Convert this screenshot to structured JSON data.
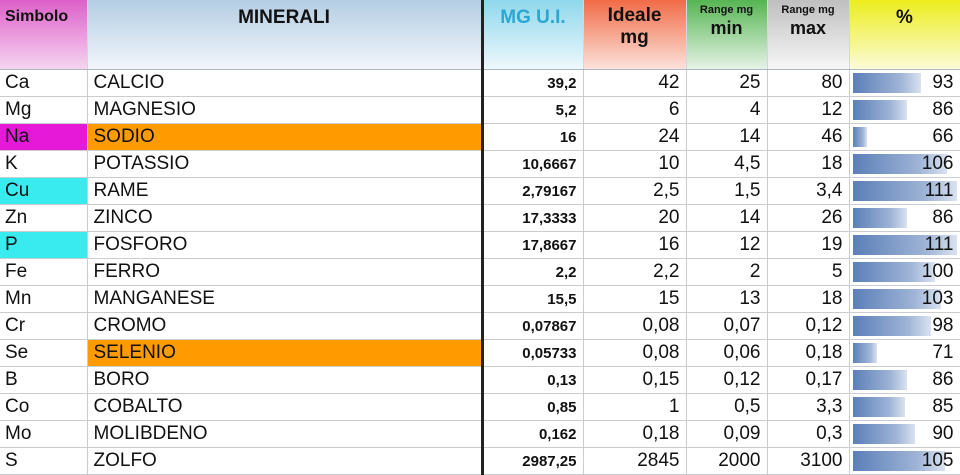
{
  "headers": {
    "simbolo": "Simbolo",
    "minerali": "MINERALI",
    "mg_ui": "MG U.I.",
    "ideale_line1": "Ideale",
    "ideale_line2": "mg",
    "range_min_line1": "Range mg",
    "range_min_line2": "min",
    "range_max_line1": "Range mg",
    "range_max_line2": "max",
    "pct": "%"
  },
  "colors": {
    "highlight_magenta": "#e619d8",
    "highlight_orange": "#ff9a00",
    "highlight_cyan": "#39ebee",
    "bar_blue": "#5b7fb8"
  },
  "rows": [
    {
      "symbol": "Ca",
      "mineral": "CALCIO",
      "mg_ui": "39,2",
      "ideale": "42",
      "min": "25",
      "max": "80",
      "pct": "93",
      "pct_value": 93
    },
    {
      "symbol": "Mg",
      "mineral": "MAGNESIO",
      "mg_ui": "5,2",
      "ideale": "6",
      "min": "4",
      "max": "12",
      "pct": "86",
      "pct_value": 86
    },
    {
      "symbol": "Na",
      "mineral": "SODIO",
      "mg_ui": "16",
      "ideale": "24",
      "min": "14",
      "max": "46",
      "pct": "66",
      "pct_value": 66
    },
    {
      "symbol": "K",
      "mineral": "POTASSIO",
      "mg_ui": "10,6667",
      "ideale": "10",
      "min": "4,5",
      "max": "18",
      "pct": "106",
      "pct_value": 106
    },
    {
      "symbol": "Cu",
      "mineral": "RAME",
      "mg_ui": "2,79167",
      "ideale": "2,5",
      "min": "1,5",
      "max": "3,4",
      "pct": "111",
      "pct_value": 111
    },
    {
      "symbol": "Zn",
      "mineral": "ZINCO",
      "mg_ui": "17,3333",
      "ideale": "20",
      "min": "14",
      "max": "26",
      "pct": "86",
      "pct_value": 86
    },
    {
      "symbol": "P",
      "mineral": "FOSFORO",
      "mg_ui": "17,8667",
      "ideale": "16",
      "min": "12",
      "max": "19",
      "pct": "111",
      "pct_value": 111
    },
    {
      "symbol": "Fe",
      "mineral": "FERRO",
      "mg_ui": "2,2",
      "ideale": "2,2",
      "min": "2",
      "max": "5",
      "pct": "100",
      "pct_value": 100
    },
    {
      "symbol": "Mn",
      "mineral": "MANGANESE",
      "mg_ui": "15,5",
      "ideale": "15",
      "min": "13",
      "max": "18",
      "pct": "103",
      "pct_value": 103
    },
    {
      "symbol": "Cr",
      "mineral": "CROMO",
      "mg_ui": "0,07867",
      "ideale": "0,08",
      "min": "0,07",
      "max": "0,12",
      "pct": "98",
      "pct_value": 98
    },
    {
      "symbol": "Se",
      "mineral": "SELENIO",
      "mg_ui": "0,05733",
      "ideale": "0,08",
      "min": "0,06",
      "max": "0,18",
      "pct": "71",
      "pct_value": 71
    },
    {
      "symbol": "B",
      "mineral": "BORO",
      "mg_ui": "0,13",
      "ideale": "0,15",
      "min": "0,12",
      "max": "0,17",
      "pct": "86",
      "pct_value": 86
    },
    {
      "symbol": "Co",
      "mineral": "COBALTO",
      "mg_ui": "0,85",
      "ideale": "1",
      "min": "0,5",
      "max": "3,3",
      "pct": "85",
      "pct_value": 85
    },
    {
      "symbol": "Mo",
      "mineral": "MOLIBDENO",
      "mg_ui": "0,162",
      "ideale": "0,18",
      "min": "0,09",
      "max": "0,3",
      "pct": "90",
      "pct_value": 90
    },
    {
      "symbol": "S",
      "mineral": "ZOLFO",
      "mg_ui": "2987,25",
      "ideale": "2845",
      "min": "2000",
      "max": "3100",
      "pct": "105",
      "pct_value": 105
    }
  ]
}
